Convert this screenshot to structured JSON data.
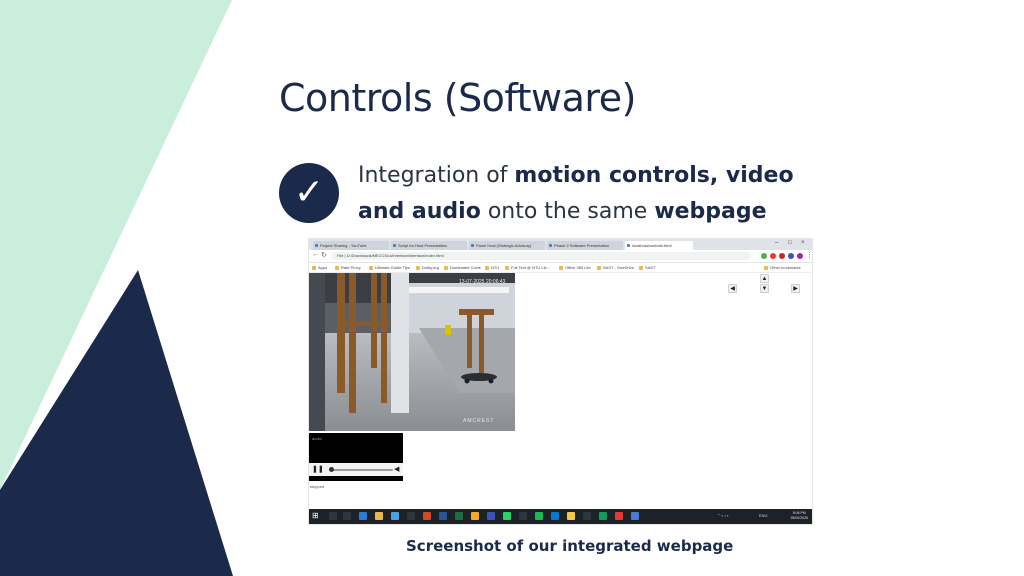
{
  "slide": {
    "title": "Controls (Software)",
    "check_glyph": "✓",
    "bullet": {
      "part1": "Integration of ",
      "bold1": "motion controls, video",
      "bold2": "and audio",
      "part2": " onto the same ",
      "bold3": "webpage"
    },
    "caption": "Screenshot of our integrated webpage",
    "colors": {
      "mint": "#c9efdc",
      "navy": "#1b2a4a"
    }
  },
  "screenshot": {
    "tabs": [
      "Project Sharing - YouTube",
      "Script for Host Presentation",
      "Panel Host (Strategic Advisory)",
      "Phase 2 Software Presentation",
      "localhost/controls.html"
    ],
    "address": "File  |  D:/Downloads/MECCS/ui/interface/interface/index.html",
    "bookmarks": [
      "Apps",
      "Rate Proxy",
      "Ultimate Guide Tips",
      "Dolby.org",
      "Dominated Coins",
      "NTU",
      "Full Text @ NTU Lib...",
      "Office 365 Lite",
      "SAST - OneDrive",
      "SAST"
    ],
    "bookmarks_right": "Other bookmarks",
    "camera_overlay": "13-07-2025 20:06:43",
    "camera_brand": "AMCREST",
    "controls": {
      "up": "▲",
      "down": "▼",
      "left": "◀",
      "right": "▶"
    },
    "audio_label": "audio",
    "audio_status": "stopped",
    "taskbar_clock": {
      "time": "8:06 PM",
      "date": "25/02/2025"
    },
    "taskbar_lang": "ENG"
  }
}
